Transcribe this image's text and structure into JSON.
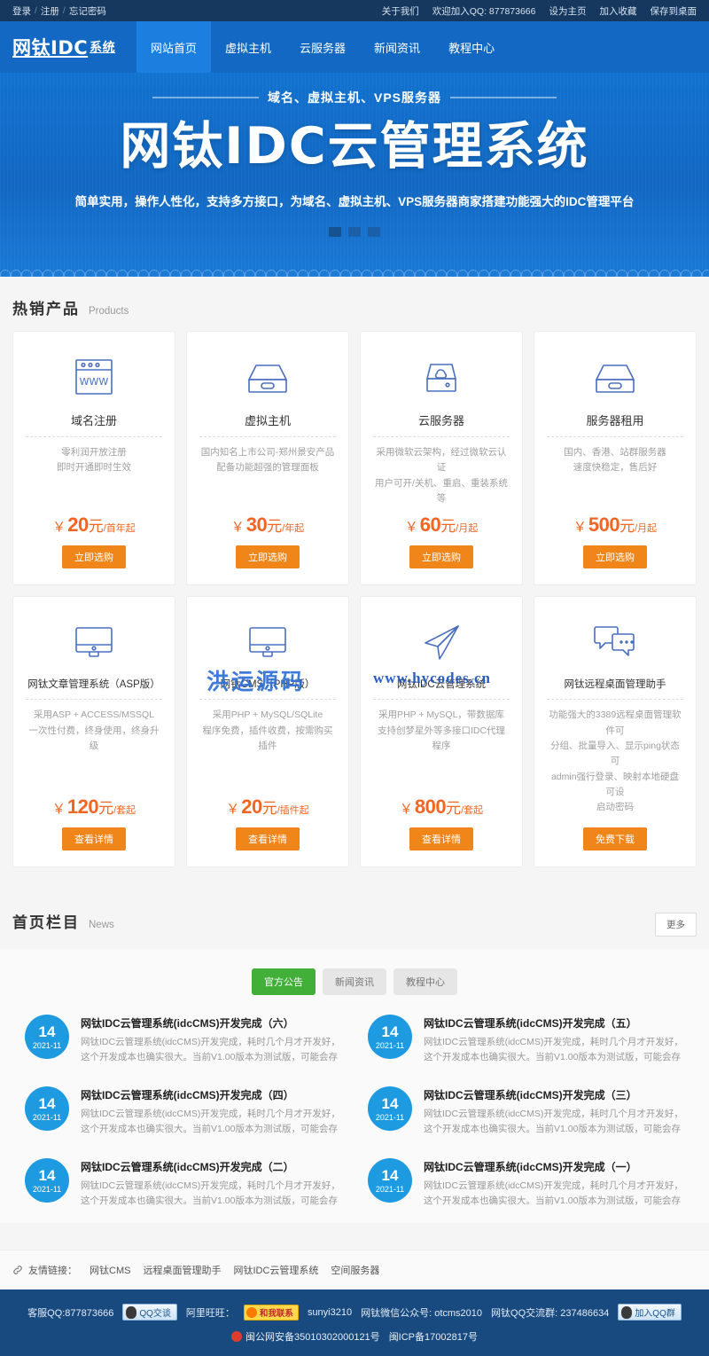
{
  "topbar": {
    "left": {
      "login": "登录",
      "register": "注册",
      "forgot": "忘记密码",
      "sep": "/"
    },
    "right": [
      {
        "label": "关于我们"
      },
      {
        "label": "欢迎加入QQ: 877873666"
      },
      {
        "label": "设为主页"
      },
      {
        "label": "加入收藏"
      },
      {
        "label": "保存到桌面"
      }
    ]
  },
  "header": {
    "logo_main": "网钛IDC",
    "logo_sub": "系统",
    "nav": [
      {
        "label": "网站首页",
        "active": true
      },
      {
        "label": "虚拟主机",
        "active": false
      },
      {
        "label": "云服务器",
        "active": false
      },
      {
        "label": "新闻资讯",
        "active": false
      },
      {
        "label": "教程中心",
        "active": false
      }
    ]
  },
  "hero": {
    "subtitle": "域名、虚拟主机、VPS服务器",
    "title": "网钛IDC云管理系统",
    "description": "简单实用，操作人性化，支持多方接口，为域名、虚拟主机、VPS服务器商家搭建功能强大的IDC管理平台",
    "dots": 3,
    "active_dot": 0
  },
  "products_section": {
    "title_cn": "热销产品",
    "title_en": "Products",
    "cards": [
      {
        "icon": "browser-window-icon",
        "title": "域名注册",
        "desc_lines": [
          "零利润开放注册",
          "即时开通即时生效"
        ],
        "price_yen": "￥",
        "price_num": "20",
        "price_yuan": "元",
        "price_unit": "/首年起",
        "button": "立即选购"
      },
      {
        "icon": "server-box-icon",
        "title": "虚拟主机",
        "desc_lines": [
          "国内知名上市公司-郑州景安产品",
          "配备功能超强的管理面板"
        ],
        "price_yen": "￥",
        "price_num": "30",
        "price_yuan": "元",
        "price_unit": "/年起",
        "button": "立即选购"
      },
      {
        "icon": "cloud-server-icon",
        "title": "云服务器",
        "desc_lines": [
          "采用微软云架构，经过微软云认证",
          "用户可开/关机、重启、重装系统等"
        ],
        "price_yen": "￥",
        "price_num": "60",
        "price_yuan": "元",
        "price_unit": "/月起",
        "button": "立即选购"
      },
      {
        "icon": "rack-server-icon",
        "title": "服务器租用",
        "desc_lines": [
          "国内、香港、站群服务器",
          "速度快稳定，售后好"
        ],
        "price_yen": "￥",
        "price_num": "500",
        "price_yuan": "元",
        "price_unit": "/月起",
        "button": "立即选购"
      },
      {
        "icon": "monitor-icon",
        "title": "网钛文章管理系统（ASP版）",
        "desc_lines": [
          "采用ASP + ACCESS/MSSQL",
          "一次性付费，终身使用，终身升级"
        ],
        "price_yen": "￥",
        "price_num": "120",
        "price_yuan": "元",
        "price_unit": "/套起",
        "button": "查看详情"
      },
      {
        "icon": "monitor-icon",
        "title": "网钛CMS（PHP版）",
        "desc_lines": [
          "采用PHP + MySQL/SQLite",
          "程序免费，插件收费，按需购买插件"
        ],
        "price_yen": "￥",
        "price_num": "20",
        "price_yuan": "元",
        "price_unit": "/插件起",
        "button": "查看详情"
      },
      {
        "icon": "paper-plane-icon",
        "title": "网钛IDC云管理系统",
        "desc_lines": [
          "采用PHP + MySQL，带数据库",
          "支持创梦星外等多接口IDC代理程序"
        ],
        "price_yen": "￥",
        "price_num": "800",
        "price_yuan": "元",
        "price_unit": "/套起",
        "button": "查看详情"
      },
      {
        "icon": "chat-bubbles-icon",
        "title": "网钛远程桌面管理助手",
        "desc_lines": [
          "功能强大的3389远程桌面管理软件可",
          "分组、批量导入、显示ping状态可",
          "admin强行登录、映射本地硬盘可设",
          "启动密码"
        ],
        "price_yen": "",
        "price_num": "",
        "price_yuan": "",
        "price_unit": "",
        "button": "免费下载"
      }
    ]
  },
  "news_section": {
    "title_cn": "首页栏目",
    "title_en": "News",
    "more_label": "更多",
    "tabs": [
      {
        "label": "官方公告",
        "active": true
      },
      {
        "label": "新闻资讯",
        "active": false
      },
      {
        "label": "教程中心",
        "active": false
      }
    ],
    "items": [
      {
        "day": "14",
        "month": "2021-11",
        "title": "网钛IDC云管理系统(idcCMS)开发完成（六）",
        "summary": "网钛IDC云管理系统(idcCMS)开发完成，耗时几个月才开发好，这个开发成本也确实很大。当前V1.00版本为测试版，可能会存在些问题还没"
      },
      {
        "day": "14",
        "month": "2021-11",
        "title": "网钛IDC云管理系统(idcCMS)开发完成（五）",
        "summary": "网钛IDC云管理系统(idcCMS)开发完成，耗时几个月才开发好，这个开发成本也确实很大。当前V1.00版本为测试版，可能会存在些问题还没"
      },
      {
        "day": "14",
        "month": "2021-11",
        "title": "网钛IDC云管理系统(idcCMS)开发完成（四）",
        "summary": "网钛IDC云管理系统(idcCMS)开发完成，耗时几个月才开发好，这个开发成本也确实很大。当前V1.00版本为测试版，可能会存在些问题还没"
      },
      {
        "day": "14",
        "month": "2021-11",
        "title": "网钛IDC云管理系统(idcCMS)开发完成（三）",
        "summary": "网钛IDC云管理系统(idcCMS)开发完成，耗时几个月才开发好，这个开发成本也确实很大。当前V1.00版本为测试版，可能会存在些问题还没"
      },
      {
        "day": "14",
        "month": "2021-11",
        "title": "网钛IDC云管理系统(idcCMS)开发完成（二）",
        "summary": "网钛IDC云管理系统(idcCMS)开发完成，耗时几个月才开发好，这个开发成本也确实很大。当前V1.00版本为测试版，可能会存在些问题还没"
      },
      {
        "day": "14",
        "month": "2021-11",
        "title": "网钛IDC云管理系统(idcCMS)开发完成（一）",
        "summary": "网钛IDC云管理系统(idcCMS)开发完成，耗时几个月才开发好，这个开发成本也确实很大。当前V1.00版本为测试版，可能会存在些问题还没"
      }
    ]
  },
  "friendly_links": {
    "label": "友情链接：",
    "items": [
      {
        "label": "网钛CMS"
      },
      {
        "label": "远程桌面管理助手"
      },
      {
        "label": "网钛IDC云管理系统"
      },
      {
        "label": "空间服务器"
      }
    ]
  },
  "footer": {
    "service_qq": "客服QQ:877873666",
    "qq_button": "QQ交谈",
    "wangwang_label": "阿里旺旺：",
    "wangwang_badge": "和我联系",
    "wangwang_id": "sunyi3210",
    "wechat": "网钛微信公众号: otcms2010",
    "qq_group": "网钛QQ交流群: 237486634",
    "qq_group_button": "加入QQ群",
    "police_record": "闽公网安备35010302000121号",
    "icp_record": "闽ICP备17002817号"
  },
  "watermarks": {
    "wm_main": "洪运源码",
    "wm_url": "www.hycodes.cn"
  },
  "colors": {
    "topbar_bg": "#16385f",
    "header_blue": "#1268c3",
    "nav_active": "#1c7ede",
    "accent_orange": "#f08519",
    "price_orange": "#f26522",
    "tab_green": "#42af38",
    "date_blue": "#1e9be0",
    "footer_blue": "#184a80",
    "icon_blue": "#4a6fbf"
  }
}
